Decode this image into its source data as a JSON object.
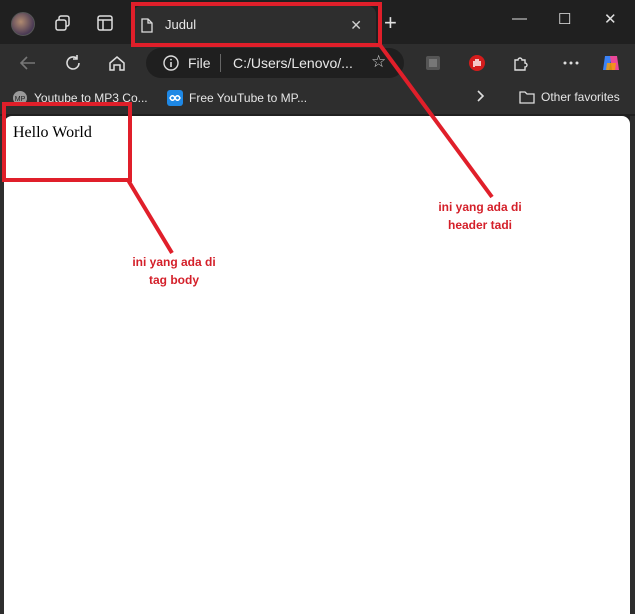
{
  "tab": {
    "title": "Judul",
    "close": "✕"
  },
  "new_tab": "+",
  "window": {
    "minimize": "—",
    "maximize": "☐",
    "close": "✕"
  },
  "address": {
    "scheme_label": "File",
    "url": "C:/Users/Lenovo/..."
  },
  "bookmarks": {
    "item1": "Youtube to MP3 Co...",
    "item2": "Free YouTube to MP...",
    "other": "Other favorites"
  },
  "page": {
    "body_text": "Hello World"
  },
  "annotations": {
    "header_note_line1": "ini yang ada di",
    "header_note_line2": "header tadi",
    "body_note_line1": "ini yang ada di",
    "body_note_line2": "tag body"
  },
  "colors": {
    "annotation_red": "#e01f2a",
    "chrome_dark": "#202020",
    "toolbar": "#2e2e2e"
  },
  "icons": [
    "profile-avatar",
    "workspaces-icon",
    "tab-actions-icon",
    "page-icon",
    "back-icon",
    "refresh-icon",
    "home-icon",
    "info-icon",
    "star-icon",
    "extension-box-icon",
    "adblock-hand-icon",
    "puzzle-icon",
    "more-icon",
    "copilot-icon",
    "chevron-right-icon",
    "folder-icon"
  ]
}
